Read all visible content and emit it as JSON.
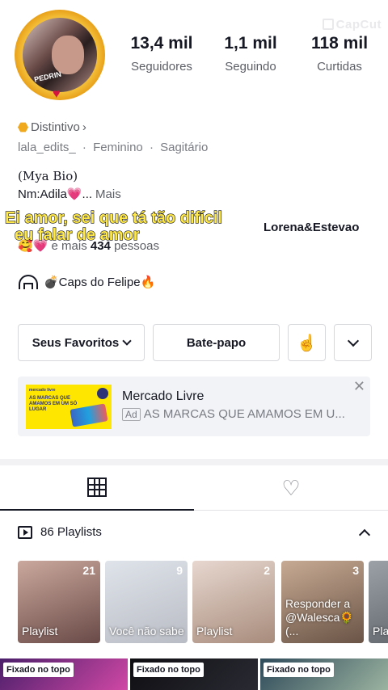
{
  "watermark": {
    "text": "CapCut"
  },
  "profile": {
    "avatar_tag": "PEDRIN",
    "stats": [
      {
        "value": "13,4 mil",
        "label": "Seguidores"
      },
      {
        "value": "1,1 mil",
        "label": "Seguindo"
      },
      {
        "value": "118 mil",
        "label": "Curtidas"
      }
    ],
    "badge_label": "Distintivo",
    "badge_chevron": "›",
    "username": "lala_edits_",
    "gender": "Feminino",
    "sign": "Sagitário",
    "meta_sep": "·",
    "bio_line1": "(Mya Bio)",
    "bio_line2": "Nm:Adila💗...",
    "bio_more": "Mais",
    "followers_names": "Lorena&Estevao",
    "followers_more_prefix": "🥰💗 e mais",
    "followers_more_count": "434",
    "followers_more_suffix": "pessoas",
    "caption_line1": "Ei amor, sei que tá tão difícil",
    "caption_line2": "eu falar de amor",
    "link_text": "💣Caps do Felipe🔥"
  },
  "buttons": {
    "favorites": "Seus Favoritos",
    "chat": "Bate-papo",
    "hand_icon": "☝"
  },
  "ad": {
    "brand_img": "mercado livre",
    "img_copy": "AS MARCAS QUE AMAMOS EM UM SÓ LUGAR",
    "title": "Mercado Livre",
    "label": "Ad",
    "subtitle": "AS MARCAS QUE AMAMOS EM U...",
    "close": "✕"
  },
  "tabs": {
    "heart": "♡"
  },
  "playlists": {
    "title": "86 Playlists",
    "items": [
      {
        "count": "21",
        "label": "Playlist",
        "colors": [
          "#caa89d",
          "#6a4a47"
        ]
      },
      {
        "count": "9",
        "label": "Você não sabe",
        "colors": [
          "#dfe3ea",
          "#b9bcc4"
        ]
      },
      {
        "count": "2",
        "label": "Playlist",
        "colors": [
          "#e7d7cf",
          "#a88c7c"
        ]
      },
      {
        "count": "3",
        "label": "Responder a @Walesca🌻(...",
        "colors": [
          "#c7aa93",
          "#6a5446"
        ]
      },
      {
        "count": "",
        "label": "Pla",
        "colors": [
          "#9ba1a7",
          "#5a6066"
        ]
      }
    ]
  },
  "videos": {
    "pinned_label": "Fixado no topo",
    "items": [
      {
        "colors": [
          "#4b1f6b",
          "#d048a5"
        ]
      },
      {
        "colors": [
          "#0e0e12",
          "#2a2a33"
        ]
      },
      {
        "colors": [
          "#2f4a5a",
          "#9bb3a0"
        ]
      }
    ]
  }
}
